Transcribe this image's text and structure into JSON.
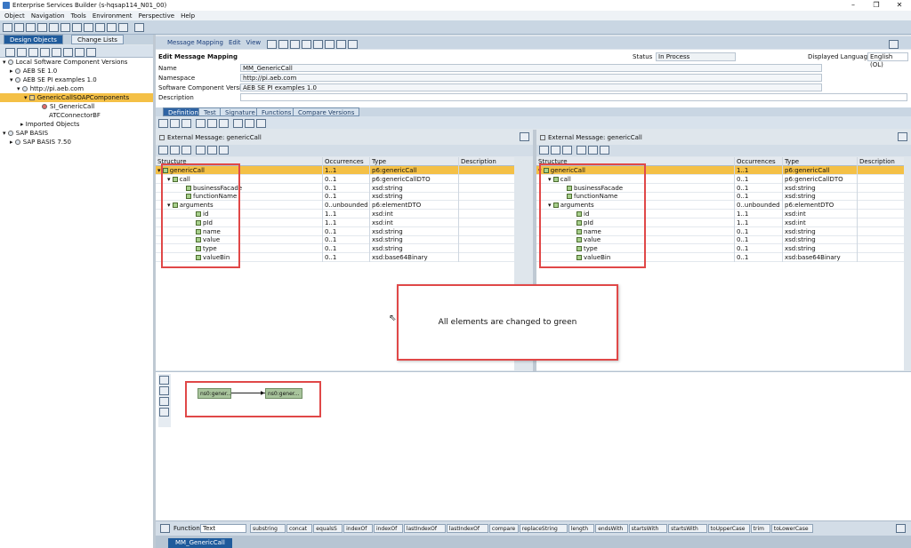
{
  "window": {
    "title": "Enterprise Services Builder (s-hqsap114_N01_00)"
  },
  "menu": [
    "Object",
    "Navigation",
    "Tools",
    "Environment",
    "Perspective",
    "Help"
  ],
  "left": {
    "tabs": [
      "Design Objects",
      "Change Lists"
    ],
    "tree": [
      {
        "label": "Local Software Component Versions",
        "level": 0
      },
      {
        "label": "AEB SE 1.0",
        "level": 1
      },
      {
        "label": "AEB SE PI examples 1.0",
        "level": 1
      },
      {
        "label": "http://pi.aeb.com",
        "level": 2
      },
      {
        "label": "GenericCallSOAPComponents",
        "level": 3,
        "selected": true
      },
      {
        "label": "SI_GenericCall",
        "level": 4
      },
      {
        "label": "ATCConnectorBF",
        "level": 4
      },
      {
        "label": "Imported Objects",
        "level": 2
      },
      {
        "label": "SAP BASIS",
        "level": 0
      },
      {
        "label": "SAP BASIS 7.50",
        "level": 1
      }
    ]
  },
  "main": {
    "menu": [
      "Message Mapping",
      "Edit",
      "View"
    ],
    "heading": "Edit Message Mapping",
    "fields": [
      {
        "label": "Name",
        "value": "MM_GenericCall"
      },
      {
        "label": "Namespace",
        "value": "http://pi.aeb.com"
      },
      {
        "label": "Software Component Version",
        "value": "AEB SE PI examples 1.0"
      },
      {
        "label": "Description",
        "value": ""
      }
    ],
    "status_label": "Status",
    "status_value": "In Process",
    "language_label": "Displayed Language",
    "language_value": "English (OL)",
    "tabs": [
      "Definition",
      "Test",
      "Signature",
      "Functions",
      "Compare Versions"
    ]
  },
  "source": {
    "title": "External Message: genericCall"
  },
  "target": {
    "title": "External Message: genericCall"
  },
  "columns": [
    "Structure",
    "Occurrences",
    "Type",
    "Description"
  ],
  "rows": [
    {
      "name": "genericCall",
      "occ": "1..1",
      "type": "p6:genericCall",
      "depth": 0
    },
    {
      "name": "call",
      "occ": "0..1",
      "type": "p6:genericCallDTO",
      "depth": 1
    },
    {
      "name": "businessFacade",
      "occ": "0..1",
      "type": "xsd:string",
      "depth": 2
    },
    {
      "name": "functionName",
      "occ": "0..1",
      "type": "xsd:string",
      "depth": 2
    },
    {
      "name": "arguments",
      "occ": "0..unbounded",
      "type": "p6:elementDTO",
      "depth": 1
    },
    {
      "name": "id",
      "occ": "1..1",
      "type": "xsd:int",
      "depth": 3
    },
    {
      "name": "pId",
      "occ": "1..1",
      "type": "xsd:int",
      "depth": 3
    },
    {
      "name": "name",
      "occ": "0..1",
      "type": "xsd:string",
      "depth": 3
    },
    {
      "name": "value",
      "occ": "0..1",
      "type": "xsd:string",
      "depth": 3
    },
    {
      "name": "type",
      "occ": "0..1",
      "type": "xsd:string",
      "depth": 3
    },
    {
      "name": "valueBin",
      "occ": "0..1",
      "type": "xsd:base64Binary",
      "depth": 3
    }
  ],
  "annotation": "All elements are changed to green",
  "graph": {
    "source_node": "ns0:gener...",
    "target_node": "ns0:gener..."
  },
  "functions": {
    "label": "Functions",
    "category": "Text",
    "items": [
      "substring",
      "concat",
      "equalsS",
      "indexOf",
      "indexOf",
      "lastIndexOf",
      "lastIndexOf",
      "compare",
      "replaceString",
      "length",
      "endsWith",
      "startsWith",
      "startsWith",
      "toUpperCase",
      "trim",
      "toLowerCase"
    ]
  },
  "bottom_tab": "MM_GenericCall"
}
